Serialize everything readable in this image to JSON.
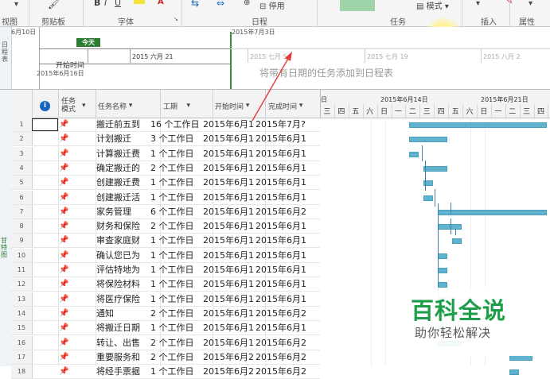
{
  "ribbon": {
    "groups": [
      "视图",
      "剪贴板",
      "字体",
      "日程",
      "任务",
      "插入",
      "属性"
    ],
    "stop_label": "停用",
    "mode_label": "模式"
  },
  "timeline": {
    "left_date_top": "6月10日",
    "today_label": "今天",
    "start_label": "开始时间",
    "start_date": "2015年6月16日",
    "top_date": "2015年7月3日",
    "dates": [
      "2015 六月 21",
      "2015 七月 5",
      "2015 七月 19",
      "2015 八月 2"
    ],
    "hint": "将带有日期的任务添加到日程表",
    "side_label": "日程表"
  },
  "table": {
    "headers": {
      "info": "i",
      "mode": "任务模式",
      "name": "任务名称",
      "duration": "工期",
      "start": "开始时间",
      "finish": "完成时间"
    },
    "rows": [
      {
        "id": "1",
        "name": "搬迁前五到",
        "duration": "16 个工作日",
        "start": "2015年6月1",
        "finish": "2015年7月?"
      },
      {
        "id": "2",
        "name": "计划搬迁",
        "duration": "3 个工作日",
        "start": "2015年6月1",
        "finish": "2015年6月1"
      },
      {
        "id": "3",
        "name": "计算搬迁费",
        "duration": "1 个工作日",
        "start": "2015年6月1",
        "finish": "2015年6月1"
      },
      {
        "id": "4",
        "name": "确定搬迁的",
        "duration": "2 个工作日",
        "start": "2015年6月1",
        "finish": "2015年6月1"
      },
      {
        "id": "5",
        "name": "创建搬迁费",
        "duration": "1 个工作日",
        "start": "2015年6月1",
        "finish": "2015年6月1"
      },
      {
        "id": "6",
        "name": "创建搬迁活",
        "duration": "1 个工作日",
        "start": "2015年6月1",
        "finish": "2015年6月1"
      },
      {
        "id": "7",
        "name": "家务管理",
        "duration": "6 个工作日",
        "start": "2015年6月1",
        "finish": "2015年6月2"
      },
      {
        "id": "8",
        "name": "财务和保险",
        "duration": "2 个工作日",
        "start": "2015年6月1",
        "finish": "2015年6月1"
      },
      {
        "id": "9",
        "name": "审查家庭财",
        "duration": "1 个工作日",
        "start": "2015年6月1",
        "finish": "2015年6月1"
      },
      {
        "id": "10",
        "name": "确认您已为",
        "duration": "1 个工作日",
        "start": "2015年6月1",
        "finish": "2015年6月1"
      },
      {
        "id": "11",
        "name": "评估特地为",
        "duration": "1 个工作日",
        "start": "2015年6月1",
        "finish": "2015年6月1"
      },
      {
        "id": "12",
        "name": "将保险材料",
        "duration": "1 个工作日",
        "start": "2015年6月1",
        "finish": "2015年6月1"
      },
      {
        "id": "13",
        "name": "将医疗保险",
        "duration": "1 个工作日",
        "start": "2015年6月1",
        "finish": "2015年6月1"
      },
      {
        "id": "14",
        "name": "通知",
        "duration": "2 个工作日",
        "start": "2015年6月1",
        "finish": "2015年6月2"
      },
      {
        "id": "15",
        "name": "将搬迁日期",
        "duration": "1 个工作日",
        "start": "2015年6月1",
        "finish": "2015年6月1"
      },
      {
        "id": "16",
        "name": "转让、出售",
        "duration": "2 个工作日",
        "start": "2015年6月1",
        "finish": "2015年6月2"
      },
      {
        "id": "17",
        "name": "重要服务和",
        "duration": "2 个工作日",
        "start": "2015年6月2",
        "finish": "2015年6月2"
      },
      {
        "id": "18",
        "name": "将经手票据",
        "duration": "1 个工作日",
        "start": "2015年6月2",
        "finish": "2015年6月2"
      }
    ]
  },
  "gantt": {
    "week_labels": [
      "日",
      "2015年6月14日",
      "2015年6月21日"
    ],
    "days": [
      "三",
      "四",
      "五",
      "六",
      "日",
      "一",
      "二",
      "三",
      "四",
      "五",
      "六",
      "日",
      "一",
      "二",
      "三",
      "四"
    ],
    "bar_color": "#5fb3cf"
  },
  "watermark": {
    "title": "百科全说",
    "subtitle": "助你轻松解决"
  }
}
